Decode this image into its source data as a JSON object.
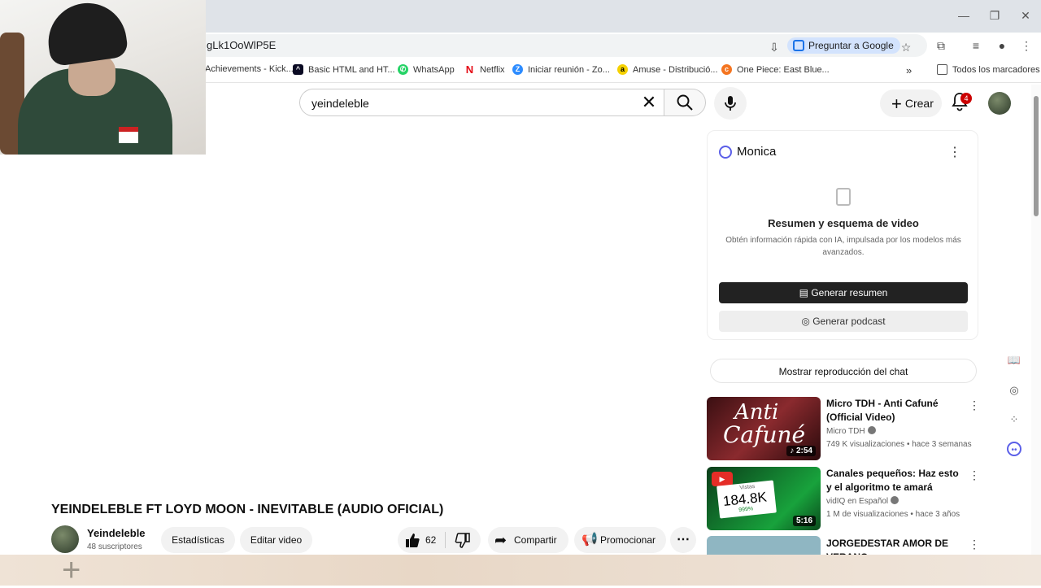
{
  "browser": {
    "url": "gLk1OoWlP5E",
    "ask_google": "Preguntar a Google",
    "bookmarks": [
      {
        "label": "Achievements - Kick...",
        "icon": "kick-icon"
      },
      {
        "label": "Basic HTML and HT...",
        "icon": "freecodecamp-icon"
      },
      {
        "label": "WhatsApp",
        "icon": "whatsapp-icon"
      },
      {
        "label": "Netflix",
        "icon": "netflix-icon"
      },
      {
        "label": "Iniciar reunión - Zo...",
        "icon": "zoom-icon"
      },
      {
        "label": "Amuse - Distribució...",
        "icon": "amuse-icon"
      },
      {
        "label": "One Piece: East Blue...",
        "icon": "crunchyroll-icon"
      }
    ],
    "all_bookmarks": "Todos los marcadores",
    "more_bookmarks": "»"
  },
  "youtube": {
    "search_value": "yeindeleble",
    "create_label": "Crear",
    "notifications_count": "4"
  },
  "monica": {
    "title": "Monica",
    "heading": "Resumen y esquema de video",
    "description": "Obtén información rápida con IA, impulsada por los modelos más avanzados.",
    "summary_button": "Generar resumen",
    "podcast_button": "Generar podcast"
  },
  "chat_replay": "Mostrar reproducción del chat",
  "recommendations": [
    {
      "title": "Micro TDH - Anti Cafuné (Official Video)",
      "channel": "Micro TDH",
      "views": "749 K visualizaciones",
      "age": "hace 3 semanas",
      "duration": "♪ 2:54",
      "thumb_text_1": "Anti",
      "thumb_text_2": "Cafuné"
    },
    {
      "title": "Canales pequeños: Haz esto y el algoritmo te amará",
      "channel": "vidIQ en Español",
      "views": "1 M de visualizaciones",
      "age": "hace 3 años",
      "duration": "5:16",
      "thumb_label": "Vistas",
      "thumb_value": "184.8K",
      "thumb_pct": "999%"
    },
    {
      "title": "JORGEDESTAR   AMOR DE VERANO",
      "channel": "",
      "views": "",
      "age": "",
      "duration": ""
    }
  ],
  "video": {
    "title": "YEINDELEBLE FT LOYD MOON - INEVITABLE (AUDIO OFICIAL)",
    "channel": "Yeindeleble",
    "subscribers": "48 suscriptores",
    "stats_button": "Estadísticas",
    "edit_button": "Editar video",
    "likes": "62",
    "share_button": "Compartir",
    "promote_button": "Promocionar"
  },
  "colors": {
    "accent": "#cc0000",
    "monica": "#5b5fe8",
    "dark_button": "#222222"
  }
}
